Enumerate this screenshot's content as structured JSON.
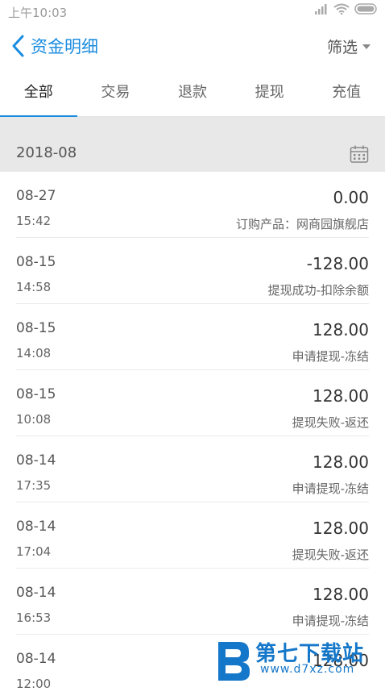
{
  "status_bar": {
    "time": "上午10:03"
  },
  "nav": {
    "title": "资金明细",
    "filter_label": "筛选"
  },
  "tabs": [
    {
      "label": "全部",
      "active": true
    },
    {
      "label": "交易",
      "active": false
    },
    {
      "label": "退款",
      "active": false
    },
    {
      "label": "提现",
      "active": false
    },
    {
      "label": "充值",
      "active": false
    }
  ],
  "month_header": {
    "label": "2018-08"
  },
  "transactions": [
    {
      "date": "08-27",
      "time": "15:42",
      "amount": "0.00",
      "desc": "订购产品：网商园旗舰店"
    },
    {
      "date": "08-15",
      "time": "14:58",
      "amount": "-128.00",
      "desc": "提现成功-扣除余额"
    },
    {
      "date": "08-15",
      "time": "14:08",
      "amount": "128.00",
      "desc": "申请提现-冻结"
    },
    {
      "date": "08-15",
      "time": "10:08",
      "amount": "128.00",
      "desc": "提现失败-返还"
    },
    {
      "date": "08-14",
      "time": "17:35",
      "amount": "128.00",
      "desc": "申请提现-冻结"
    },
    {
      "date": "08-14",
      "time": "17:04",
      "amount": "128.00",
      "desc": "提现失败-返还"
    },
    {
      "date": "08-14",
      "time": "16:53",
      "amount": "128.00",
      "desc": "申请提现-冻结"
    },
    {
      "date": "08-14",
      "time": "12:00",
      "amount": "128.00",
      "desc": ""
    }
  ],
  "watermark": {
    "text": "第七下载站",
    "url": "www.d7xz.com"
  },
  "colors": {
    "accent": "#1a8ce0",
    "month_bg": "#e8e8e8"
  }
}
